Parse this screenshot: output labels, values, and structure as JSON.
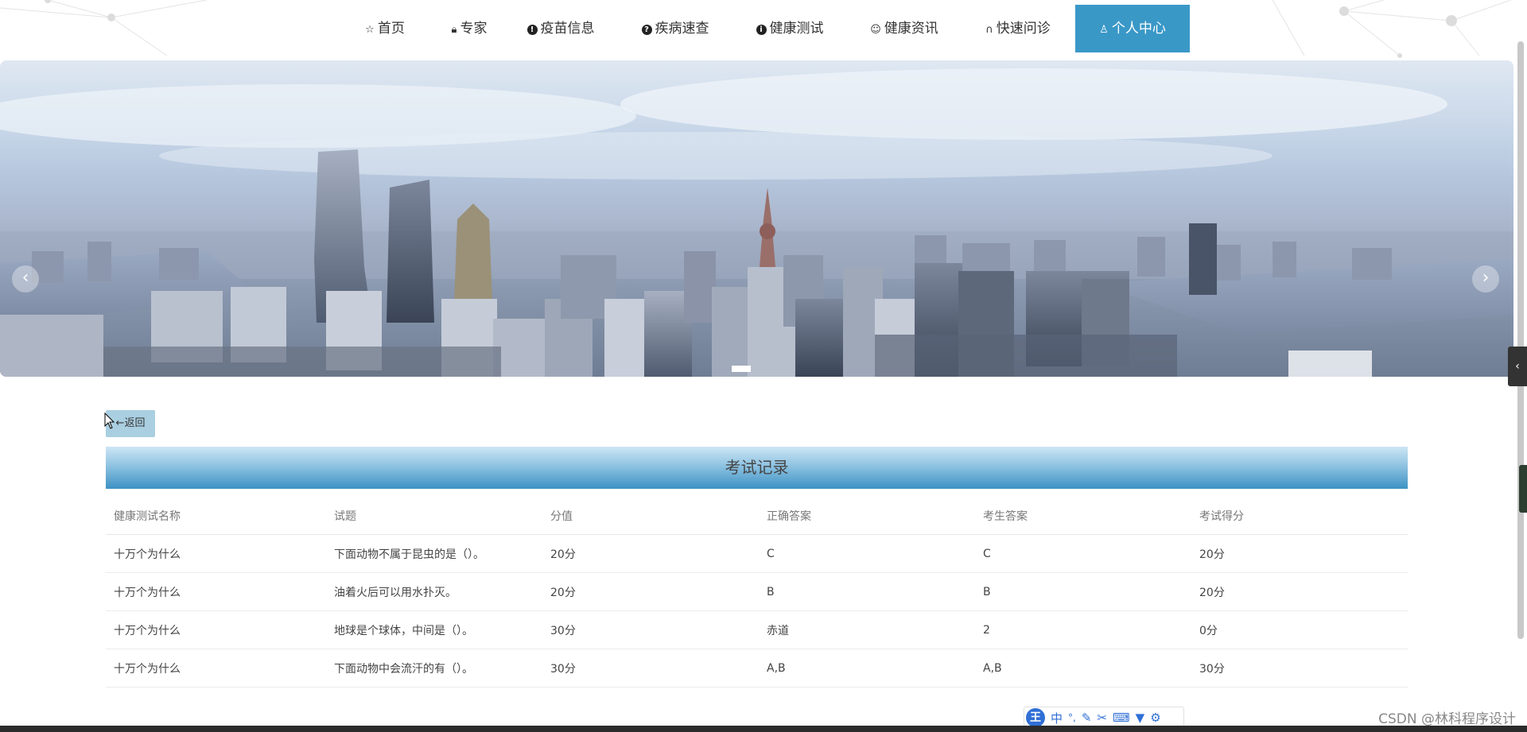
{
  "nav": {
    "items": [
      {
        "label": "首页",
        "icon": "star-icon"
      },
      {
        "label": "专家",
        "icon": "lock-icon"
      },
      {
        "label": "疫苗信息",
        "icon": "info-icon"
      },
      {
        "label": "疾病速查",
        "icon": "question-icon"
      },
      {
        "label": "健康测试",
        "icon": "info-icon"
      },
      {
        "label": "健康资讯",
        "icon": "smile-icon"
      },
      {
        "label": "快速问诊",
        "icon": "headset-icon"
      },
      {
        "label": "个人中心",
        "icon": "user-icon",
        "active": true
      }
    ]
  },
  "banner": {
    "prev": "‹",
    "next": "›"
  },
  "back_button": "←返回",
  "records": {
    "title": "考试记录",
    "columns": [
      "健康测试名称",
      "试题",
      "分值",
      "正确答案",
      "考生答案",
      "考试得分"
    ],
    "rows": [
      [
        "十万个为什么",
        "下面动物不属于昆虫的是（）。",
        "20分",
        "C",
        "C",
        "20分"
      ],
      [
        "十万个为什么",
        "油着火后可以用水扑灭。",
        "20分",
        "B",
        "B",
        "20分"
      ],
      [
        "十万个为什么",
        "地球是个球体，中间是（）。",
        "30分",
        "赤道",
        "2",
        "0分"
      ],
      [
        "十万个为什么",
        "下面动物中会流汗的有（）。",
        "30分",
        "A,B",
        "A,B",
        "30分"
      ]
    ]
  },
  "ime": {
    "logo": "王",
    "mode": "中",
    "punct": "°,"
  },
  "watermark": "CSDN @林科程序设计",
  "colors": {
    "accent": "#3a98c7",
    "title_bar_top": "#cde6f4",
    "title_bar_bottom": "#3d92c4",
    "back_button": "#a9cfe1"
  }
}
